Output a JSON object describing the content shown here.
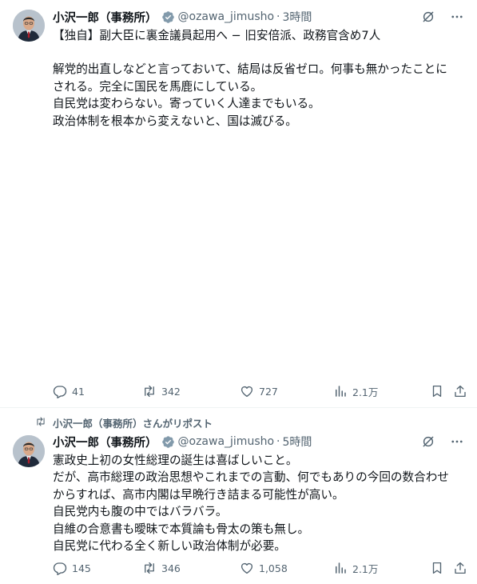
{
  "colors": {
    "text": "#0f1419",
    "muted": "#536471",
    "verified": "#829aab",
    "divider": "#eff3f4"
  },
  "tweets": [
    {
      "author": "小沢一郎（事務所）",
      "handle": "@ozawa_jimusho",
      "time": "3時間",
      "lines": [
        "【独自】副大臣に裏金議員起用へ − 旧安倍派、政務官含め7人",
        "",
        "解党的出直しなどと言っておいて、結局は反省ゼロ。何事も無かったことに",
        "される。完全に国民を馬鹿にしている。",
        "自民党は変わらない。寄っていく人達までもいる。",
        "政治体制を根本から変えないと、国は滅びる。"
      ],
      "replies": "41",
      "reposts": "342",
      "likes": "727",
      "views": "2.1万"
    },
    {
      "repost_label": "小沢一郎（事務所）さんがリポスト",
      "author": "小沢一郎（事務所）",
      "handle": "@ozawa_jimusho",
      "time": "5時間",
      "lines": [
        "憲政史上初の女性総理の誕生は喜ばしいこと。",
        "だが、高市総理の政治思想やこれまでの言動、何でもありの今回の数合わせ",
        "からすれば、高市内閣は早晩行き詰まる可能性が高い。",
        "自民党内も腹の中ではバラバラ。",
        "自維の合意書も曖昧で本質論も骨太の策も無し。",
        "自民党に代わる全く新しい政治体制が必要。"
      ],
      "replies": "145",
      "reposts": "346",
      "likes": "1,058",
      "views": "2.1万"
    }
  ],
  "separator": "·"
}
